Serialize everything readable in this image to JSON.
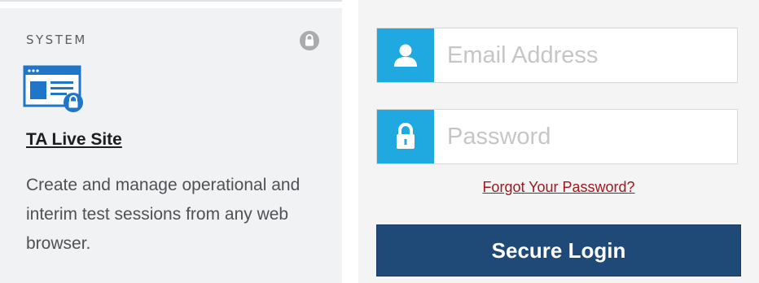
{
  "card": {
    "category": "SYSTEM",
    "title": "TA Live Site",
    "description": "Create and manage operational and interim test sessions from any web browser.",
    "badge_icon": "lock-icon",
    "app_icon": "browser-lock-icon",
    "colors": {
      "icon_blue": "#1f76c8",
      "badge_gray": "#a9acae",
      "background": "#f0f2f3"
    }
  },
  "login": {
    "email_placeholder": "Email Address",
    "email_value": "",
    "email_icon": "user-icon",
    "password_placeholder": "Password",
    "password_value": "",
    "password_icon": "lock-icon",
    "forgot_label": "Forgot Your Password?",
    "submit_label": "Secure Login",
    "colors": {
      "addon": "#20a9e0",
      "button": "#1f4a77",
      "link": "#a4161d"
    }
  }
}
